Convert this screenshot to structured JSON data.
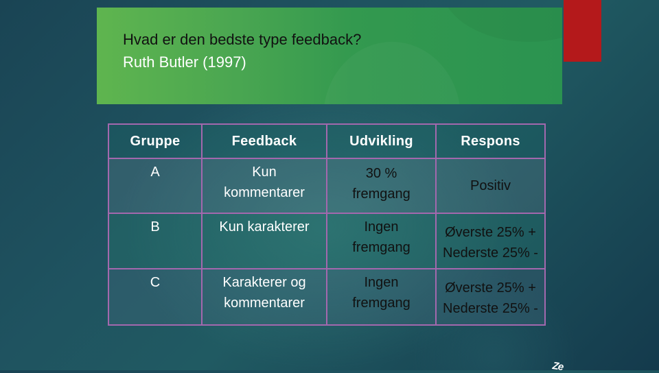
{
  "slide": {
    "title_line_1": "Hvad er den bedste type feedback?",
    "title_line_2": "Ruth Butler (1997)",
    "accent_colors": {
      "title_box_green": "#4aa651",
      "red_block": "#b4191b",
      "table_border": "#a468ae",
      "background": "#1f5360"
    },
    "footer_clipped_text": "Ze"
  },
  "table": {
    "headers": [
      "Gruppe",
      "Feedback",
      "Udvikling",
      "Respons"
    ],
    "rows": [
      {
        "gruppe": "A",
        "feedback": "Kun kommentarer",
        "udvikling": "30 % fremgang",
        "respons": "Positiv"
      },
      {
        "gruppe": "B",
        "feedback": "Kun karakterer",
        "udvikling": "Ingen fremgang",
        "respons_line_1": "Øverste 25% +",
        "respons_line_2": "Nederste 25% -"
      },
      {
        "gruppe": "C",
        "feedback": "Karakterer og kommentarer",
        "udvikling": "Ingen fremgang",
        "respons_line_1": "Øverste 25% +",
        "respons_line_2": "Nederste 25% -"
      }
    ]
  }
}
